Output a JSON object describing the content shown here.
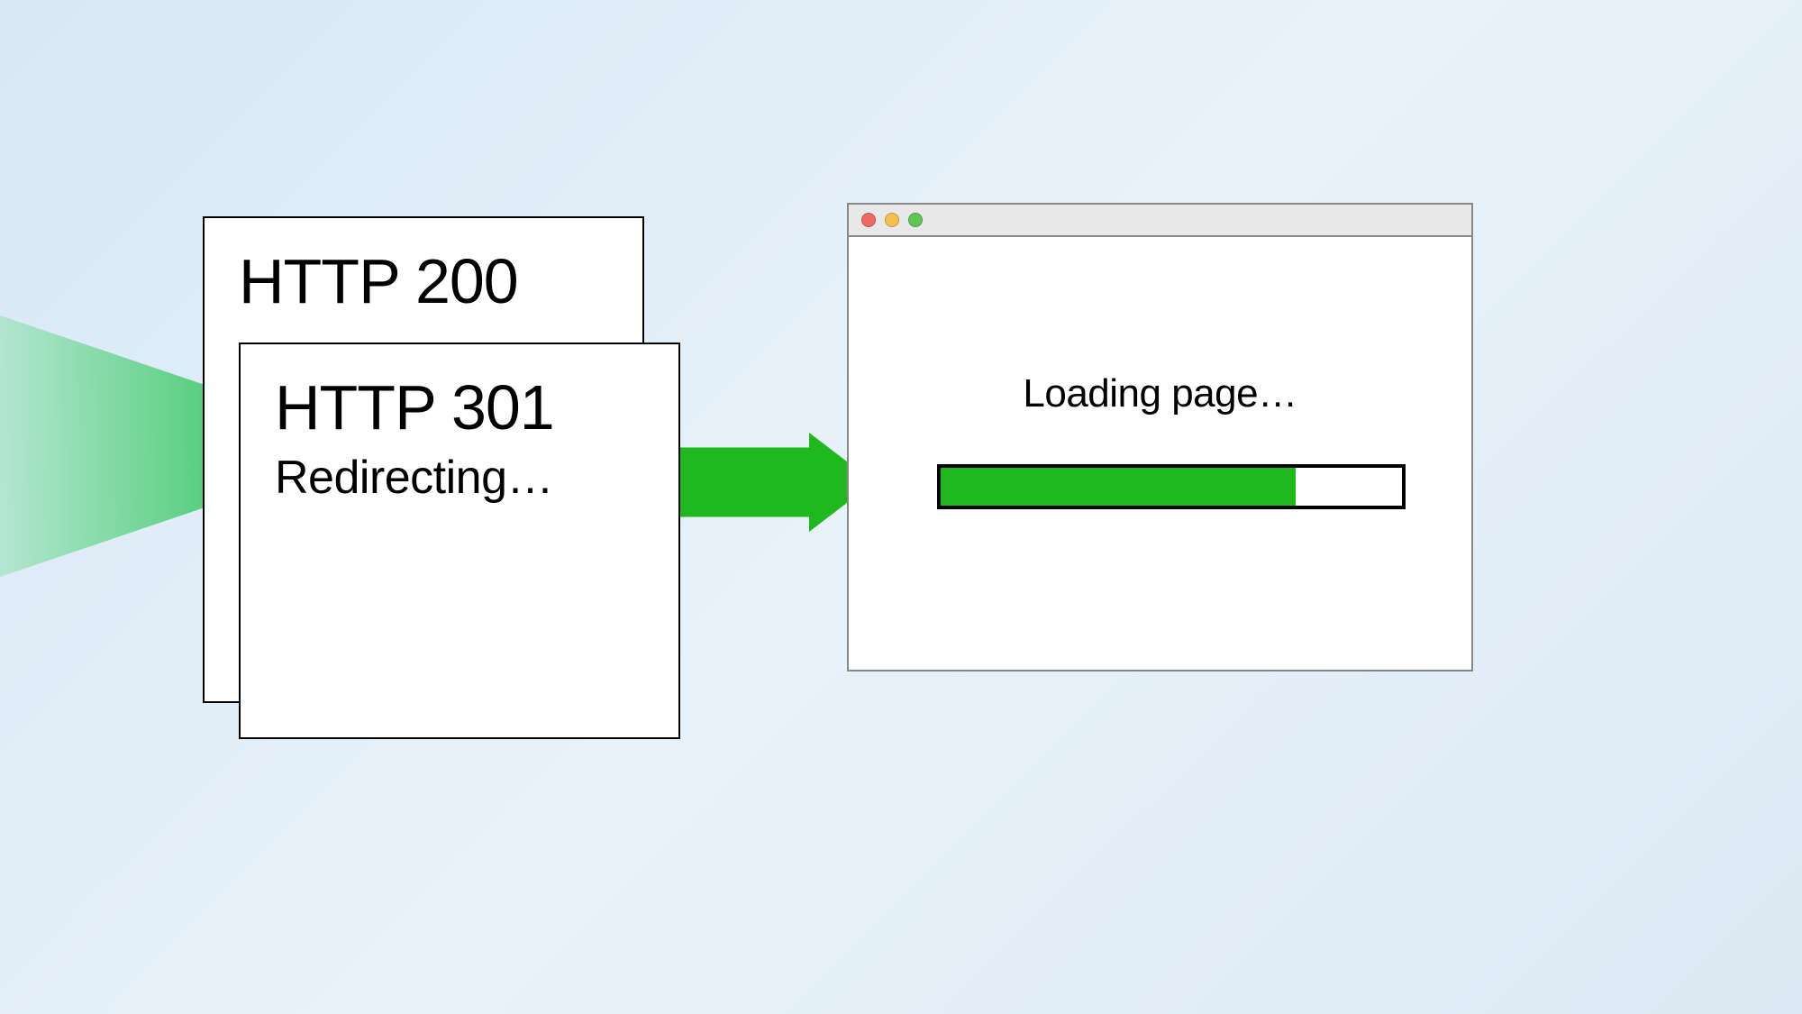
{
  "page_back": {
    "title": "HTTP 200"
  },
  "page_front": {
    "title": "HTTP 301",
    "subtitle": "Redirecting…"
  },
  "browser": {
    "loading_label": "Loading page…",
    "progress_percent": 77
  },
  "colors": {
    "arrow_green": "#1fb81f",
    "traffic_close": "#ed6a5e",
    "traffic_min": "#f5bf4f",
    "traffic_max": "#61c554"
  }
}
